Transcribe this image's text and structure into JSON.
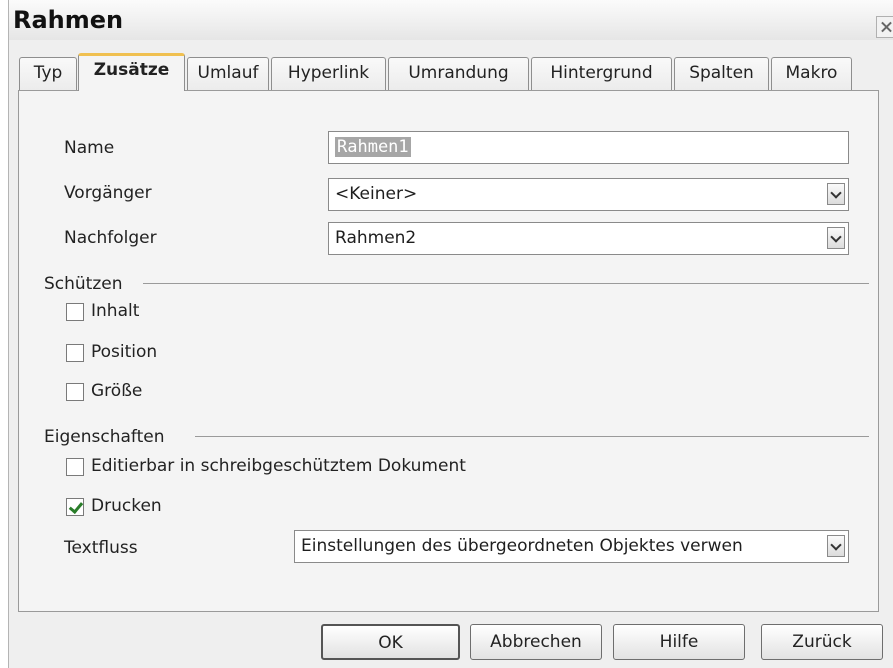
{
  "window": {
    "title": "Rahmen"
  },
  "tabs": [
    {
      "label": "Typ"
    },
    {
      "label": "Zusätze"
    },
    {
      "label": "Umlauf"
    },
    {
      "label": "Hyperlink"
    },
    {
      "label": "Umrandung"
    },
    {
      "label": "Hintergrund"
    },
    {
      "label": "Spalten"
    },
    {
      "label": "Makro"
    }
  ],
  "active_tab": "Zusätze",
  "form": {
    "name_label": "Name",
    "name_value": "Rahmen1",
    "previous_label": "Vorgänger",
    "previous_value": "<Keiner>",
    "next_label": "Nachfolger",
    "next_value": "Rahmen2"
  },
  "protect": {
    "heading": "Schützen",
    "content_label": "Inhalt",
    "content_checked": false,
    "position_label": "Position",
    "position_checked": false,
    "size_label": "Größe",
    "size_checked": false
  },
  "properties": {
    "heading": "Eigenschaften",
    "editable_label": "Editierbar in schreibgeschütztem Dokument",
    "editable_checked": false,
    "print_label": "Drucken",
    "print_checked": true,
    "textflow_label": "Textfluss",
    "textflow_value": "Einstellungen des übergeordneten Objektes verwen"
  },
  "buttons": {
    "ok": "OK",
    "cancel": "Abbrechen",
    "help": "Hilfe",
    "reset": "Zurück"
  },
  "colors": {
    "active_tab_accent": "#f0c050",
    "check_mark": "#2a7d2a",
    "selection": "#a6a6a6"
  }
}
